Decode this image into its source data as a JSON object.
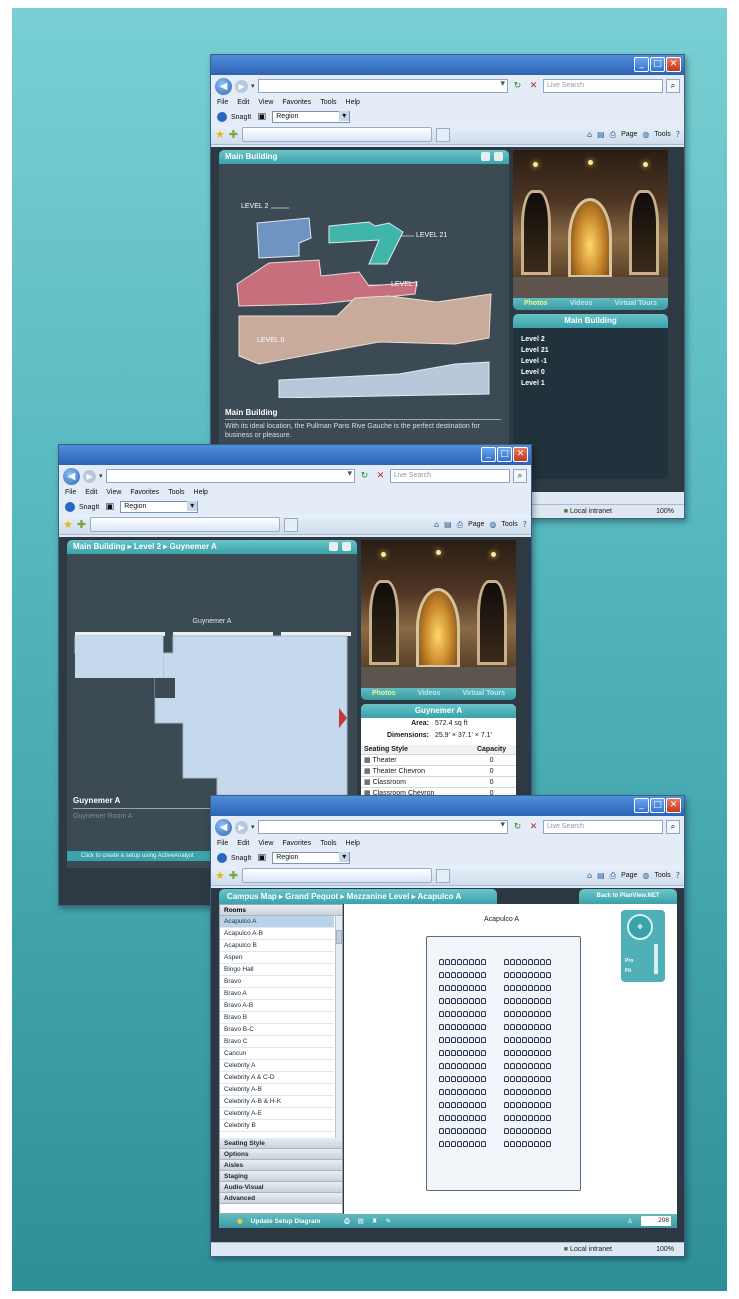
{
  "browser": {
    "search_placeholder": "Live Search",
    "menu": [
      "File",
      "Edit",
      "View",
      "Favorites",
      "Tools",
      "Help"
    ],
    "snagit_label": "SnagIt",
    "region_select": "Region",
    "cmd_page": "Page",
    "cmd_tools": "Tools",
    "status_zone": "Local intranet",
    "status_zoom": "100%"
  },
  "window1": {
    "panel_title": "Main Building",
    "level_labels": [
      "LEVEL 2",
      "LEVEL 21",
      "LEVEL 1",
      "LEVEL 0"
    ],
    "caption_title": "Main Building",
    "caption_text": "With its ideal location, the Pullman Paris Rive Gauche is the perfect destination for business or pleasure.",
    "photo_tabs": [
      "Photos",
      "Videos",
      "Virtual Tours"
    ],
    "side_header": "Main Building",
    "side_levels": [
      "Level 2",
      "Level 21",
      "Level -1",
      "Level 0",
      "Level 1"
    ]
  },
  "window2": {
    "breadcrumb": [
      "Main Building",
      "Level 2",
      "Guynemer A"
    ],
    "room_label": "Guynemer A",
    "caption_title": "Guynemer A",
    "caption_text": "Guynemer Room A",
    "footer_link": "Click to create a setup using ActiveAnalyst",
    "photo_tabs": [
      "Photos",
      "Videos",
      "Virtual Tours"
    ],
    "info_header": "Guynemer A",
    "area_label": "Area:",
    "area_value": "572.4 sq ft",
    "dim_label": "Dimensions:",
    "dim_value": "25.9' × 37.1' × 7.1'",
    "table_headers": [
      "Seating Style",
      "Capacity"
    ],
    "seating": [
      {
        "style": "Theater",
        "capacity": "0"
      },
      {
        "style": "Theater Chevron",
        "capacity": "0"
      },
      {
        "style": "Classroom",
        "capacity": "0"
      },
      {
        "style": "Classroom Chevron",
        "capacity": "0"
      }
    ]
  },
  "window3": {
    "breadcrumb": [
      "Campus Map",
      "Grand Pequot",
      "Mezzanine Level",
      "Acapulco A"
    ],
    "back_button": "Back to PlanView.NET",
    "rooms_header": "Rooms",
    "rooms": [
      "Acapulco A",
      "Acapulco A-B",
      "Acapulco B",
      "Aspen",
      "Bingo Hall",
      "Bravo",
      "Bravo A",
      "Bravo A-B",
      "Bravo B",
      "Bravo B-C",
      "Bravo C",
      "Cancun",
      "Celebrity A",
      "Celebrity A & C-D",
      "Celebrity A-B",
      "Celebrity A-B & H-K",
      "Celebrity A-E",
      "Celebrity B"
    ],
    "accordion": [
      "Seating Style",
      "Options",
      "Aisles",
      "Staging",
      "Audio-Visual",
      "Advanced"
    ],
    "room_title": "Acapulco A",
    "update_button": "Update Setup Diagram",
    "count_value": "208",
    "zoom_labels": [
      "Pro",
      "Fit"
    ]
  }
}
